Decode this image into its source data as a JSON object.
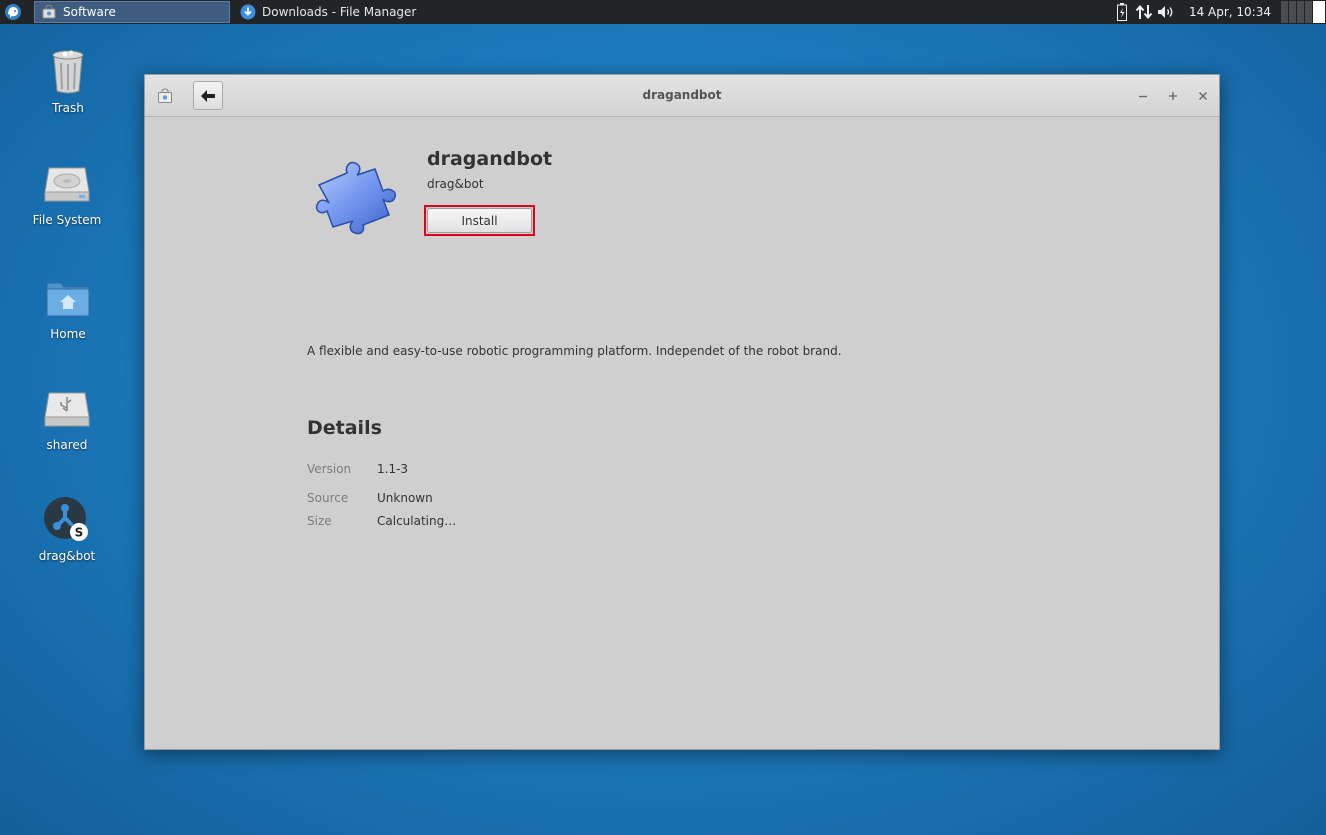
{
  "panel": {
    "tasks": [
      {
        "label": "Software",
        "active": true
      },
      {
        "label": "Downloads - File Manager",
        "active": false
      }
    ],
    "clock": "14 Apr, 10:34"
  },
  "desktop": {
    "icons": [
      {
        "label": "Trash"
      },
      {
        "label": "File System"
      },
      {
        "label": "Home"
      },
      {
        "label": "shared"
      },
      {
        "label": "drag&bot"
      }
    ]
  },
  "window": {
    "title": "dragandbot",
    "app": {
      "name": "dragandbot",
      "summary": "drag&bot",
      "install_label": "Install",
      "description": "A flexible and easy-to-use robotic programming platform. Independet of the robot brand."
    },
    "details": {
      "heading": "Details",
      "rows": [
        {
          "key": "Version",
          "value": "1.1-3"
        },
        {
          "key": "Source",
          "value": "Unknown"
        },
        {
          "key": "Size",
          "value": "Calculating…"
        }
      ]
    }
  },
  "colors": {
    "desktop_bg": "#1d7cbf",
    "panel_bg": "#222527",
    "window_bg": "#cfcfcf",
    "highlight": "#e0001b"
  }
}
